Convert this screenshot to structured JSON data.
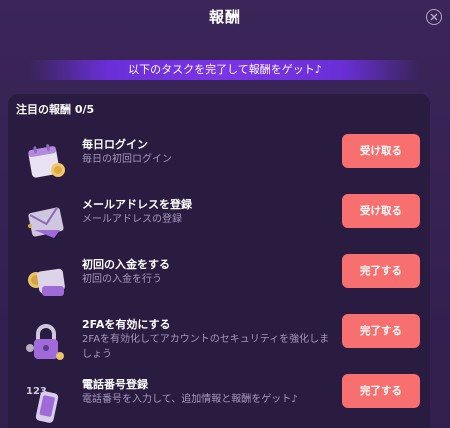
{
  "header": {
    "title": "報酬"
  },
  "banner": {
    "text": "以下のタスクを完了して報酬をゲット♪"
  },
  "panel": {
    "heading": "注目の報酬 0/5",
    "tasks": [
      {
        "title": "毎日ログイン",
        "desc": "毎日の初回ログイン",
        "button": "受け取る",
        "icon": "calendar-icon"
      },
      {
        "title": "メールアドレスを登録",
        "desc": "メールアドレスの登録",
        "button": "受け取る",
        "icon": "envelope-icon"
      },
      {
        "title": "初回の入金をする",
        "desc": "初回の入金を行う",
        "button": "完了する",
        "icon": "wallet-icon"
      },
      {
        "title": "2FAを有効にする",
        "desc": "2FAを有効化してアカウントのセキュリティを強化しましょう",
        "button": "完了する",
        "icon": "padlock-icon"
      },
      {
        "title": "電話番号登録",
        "desc": "電話番号を入力して、追加情報と報酬をゲット♪",
        "button": "完了する",
        "icon": "phone-icon"
      }
    ]
  },
  "colors": {
    "button": "#f86f6f",
    "panel": "#2a1b40",
    "background": "#3b2559",
    "banner": "#7b34e6"
  }
}
